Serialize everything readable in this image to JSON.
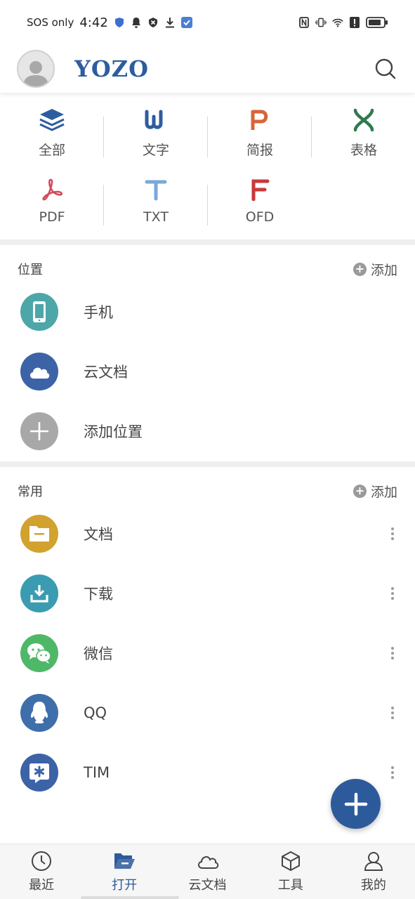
{
  "status_bar": {
    "carrier": "SOS only",
    "time": "4:42",
    "icons": [
      "shield-icon",
      "bell-icon",
      "vpn-icon",
      "download-icon",
      "app-icon",
      "nfc-icon",
      "vibrate-icon",
      "wifi-icon",
      "alert-icon",
      "battery-icon"
    ]
  },
  "header": {
    "logo": "YOZO",
    "avatar_icon": "user-icon",
    "search_icon": "search-icon"
  },
  "file_types": [
    {
      "label": "全部",
      "icon": "layers-icon",
      "color": "#2e5d9f"
    },
    {
      "label": "文字",
      "icon": "word-icon",
      "color": "#2e5d9f"
    },
    {
      "label": "简报",
      "icon": "presentation-icon",
      "color": "#d9643a"
    },
    {
      "label": "表格",
      "icon": "spreadsheet-icon",
      "color": "#2f7a4f"
    },
    {
      "label": "PDF",
      "icon": "pdf-icon",
      "color": "#d34a5a"
    },
    {
      "label": "TXT",
      "icon": "txt-icon",
      "color": "#7aa8d8"
    },
    {
      "label": "OFD",
      "icon": "ofd-icon",
      "color": "#c73a3a"
    }
  ],
  "locations": {
    "title": "位置",
    "add_label": "添加",
    "items": [
      {
        "label": "手机",
        "icon": "phone-icon",
        "color": "#4da6a8"
      },
      {
        "label": "云文档",
        "icon": "cloud-icon",
        "color": "#3d63a7"
      },
      {
        "label": "添加位置",
        "icon": "plus-icon",
        "color": "#a8a8a8"
      }
    ]
  },
  "common": {
    "title": "常用",
    "add_label": "添加",
    "items": [
      {
        "label": "文档",
        "icon": "folder-icon",
        "color": "#d1a22e"
      },
      {
        "label": "下载",
        "icon": "download-icon",
        "color": "#3b9bb0"
      },
      {
        "label": "微信",
        "icon": "wechat-icon",
        "color": "#4fb868"
      },
      {
        "label": "QQ",
        "icon": "qq-icon",
        "color": "#3f6faa"
      },
      {
        "label": "TIM",
        "icon": "tim-icon",
        "color": "#3d63a7"
      }
    ]
  },
  "fab": {
    "icon": "plus-icon"
  },
  "bottom_nav": [
    {
      "label": "最近",
      "icon": "clock-icon",
      "active": false
    },
    {
      "label": "打开",
      "icon": "folder-open-icon",
      "active": true
    },
    {
      "label": "云文档",
      "icon": "cloud-icon",
      "active": false
    },
    {
      "label": "工具",
      "icon": "cube-icon",
      "active": false
    },
    {
      "label": "我的",
      "icon": "user-icon",
      "active": false
    }
  ],
  "colors": {
    "accent": "#2d5a9b",
    "divider": "#efefef"
  }
}
